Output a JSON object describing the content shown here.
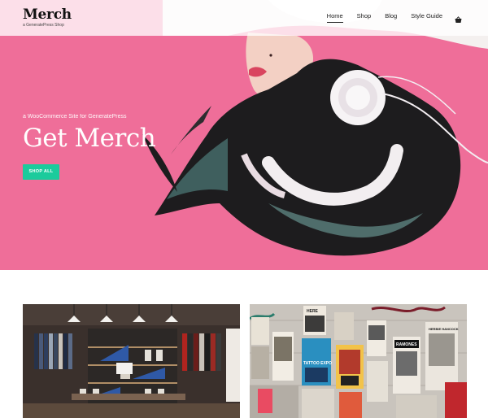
{
  "header": {
    "site_title": "Merch",
    "tagline": "a GeneratePress Shop",
    "nav": [
      {
        "label": "Home",
        "active": true
      },
      {
        "label": "Shop",
        "active": false
      },
      {
        "label": "Blog",
        "active": false
      },
      {
        "label": "Style Guide",
        "active": false
      }
    ],
    "cart_icon": "shopping-basket-icon"
  },
  "hero": {
    "kicker": "a WooCommerce Site for GeneratePress",
    "title": "Get Merch",
    "button_label": "SHOP ALL",
    "background_color": "#ef6e99",
    "button_color": "#1bcb9c"
  },
  "posters": {
    "top_left": "HERE",
    "lines": [
      "TATTOO EXPO",
      "RAMONES",
      "HERBIE HANCOCK"
    ]
  }
}
